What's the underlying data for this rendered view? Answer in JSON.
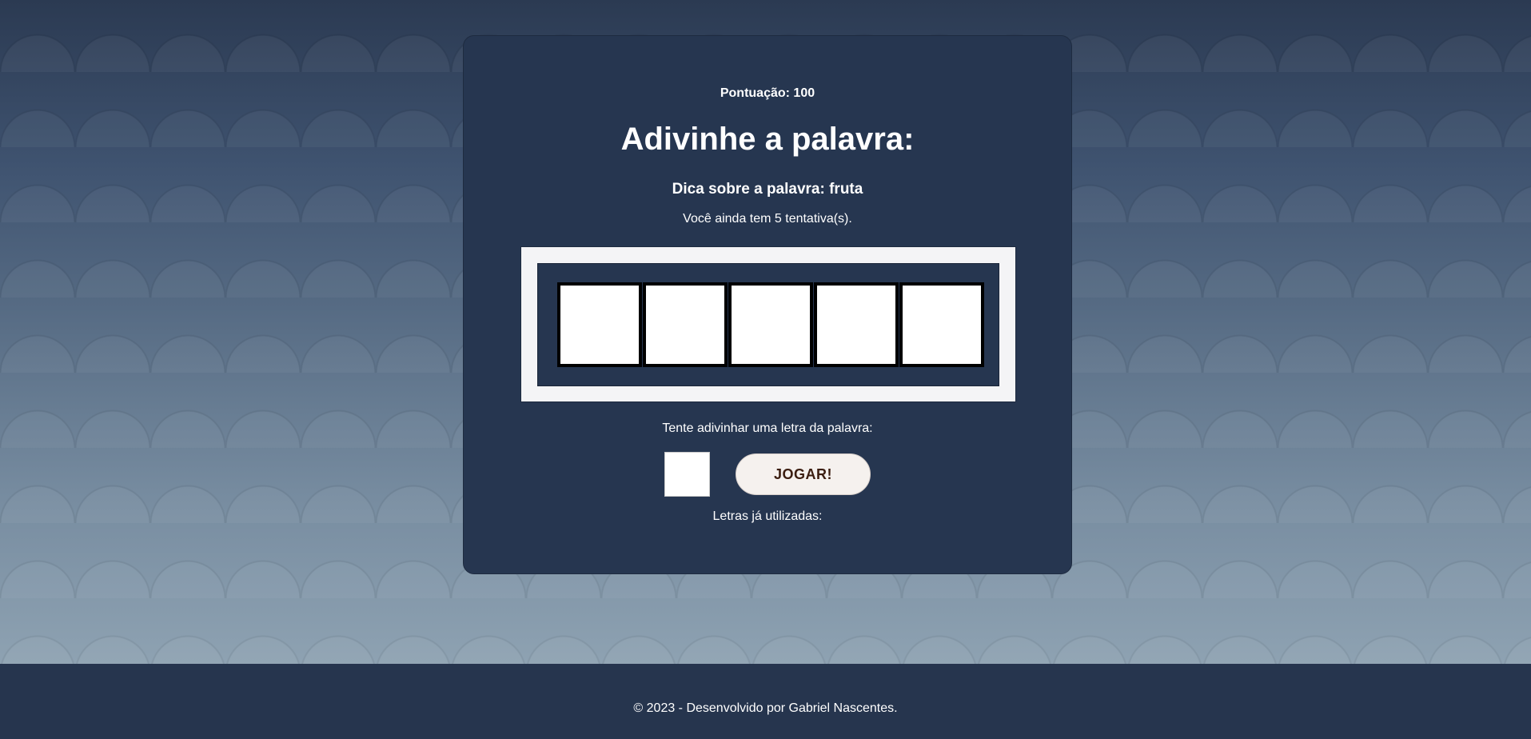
{
  "game": {
    "score_text": "Pontuação: 100",
    "title": "Adivinhe a palavra:",
    "hint": "Dica sobre a palavra: fruta",
    "attempts_text": "Você ainda tem 5 tentativa(s).",
    "letter_slots": [
      "",
      "",
      "",
      "",
      ""
    ],
    "prompt": "Tente adivinhar uma letra da palavra:",
    "letter_input_value": "",
    "play_button": "JOGAR!",
    "used_letters_label": "Letras já utilizadas:"
  },
  "footer": {
    "text": "© 2023 - Desenvolvido por Gabriel Nascentes."
  }
}
